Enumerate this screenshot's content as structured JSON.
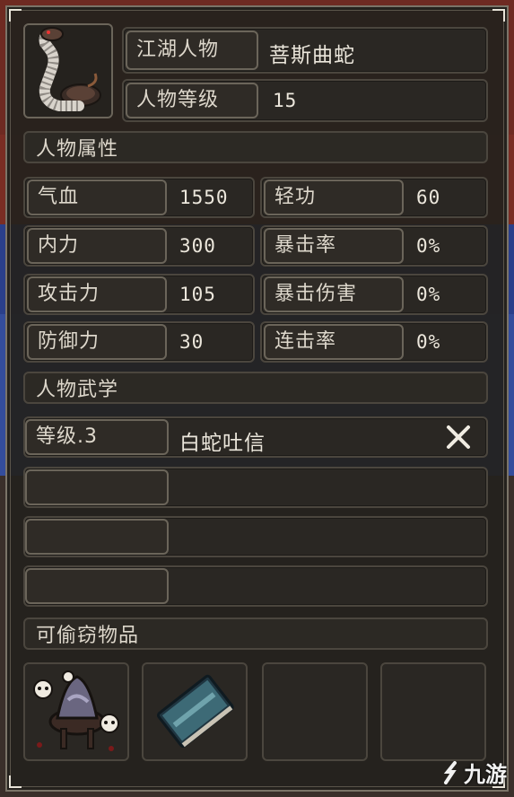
{
  "profile": {
    "name_label": "江湖人物",
    "name_value": "菩斯曲蛇",
    "level_label": "人物等级",
    "level_value": "15"
  },
  "sections": {
    "attributes": "人物属性",
    "martial": "人物武学",
    "steal": "可偷窃物品"
  },
  "stats": {
    "left": [
      {
        "label": "气血",
        "value": "1550"
      },
      {
        "label": "内力",
        "value": "300"
      },
      {
        "label": "攻击力",
        "value": "105"
      },
      {
        "label": "防御力",
        "value": "30"
      }
    ],
    "right": [
      {
        "label": "轻功",
        "value": "60"
      },
      {
        "label": "暴击率",
        "value": "0%"
      },
      {
        "label": "暴击伤害",
        "value": "0%"
      },
      {
        "label": "连击率",
        "value": "0%"
      }
    ]
  },
  "skills": [
    {
      "level": "等级.3",
      "name": "白蛇吐信"
    },
    {
      "level": "",
      "name": ""
    },
    {
      "level": "",
      "name": ""
    },
    {
      "level": "",
      "name": ""
    }
  ],
  "steal_slots": [
    {
      "icon": "cauldron-skulls-icon"
    },
    {
      "icon": "book-icon"
    },
    {
      "icon": ""
    },
    {
      "icon": ""
    }
  ],
  "icons": {
    "avatar": "snake-icon",
    "remove": "close-icon"
  },
  "watermark": {
    "text": "九游"
  },
  "colors": {
    "panel_bg": "#24211d",
    "border": "#6b655a",
    "text": "#e8e3d8",
    "bg_red": "#7a2a22",
    "bg_blue": "#2a3f8a"
  }
}
